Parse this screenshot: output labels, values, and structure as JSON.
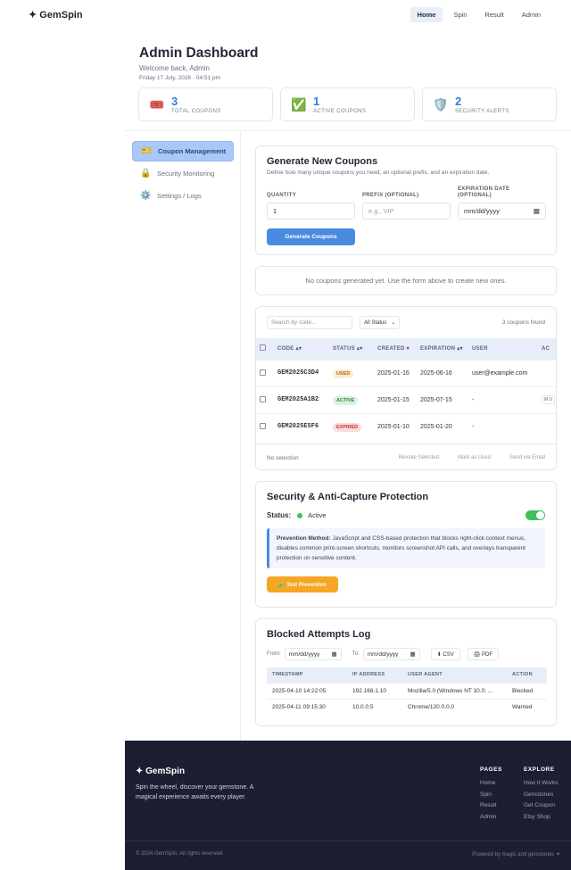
{
  "nav": {
    "brand": "✦ GemSpin",
    "links": [
      "Home",
      "Spin",
      "Result",
      "Admin"
    ],
    "active": "Home"
  },
  "header": {
    "title": "Admin Dashboard",
    "welcome": "Welcome back, Admin",
    "date": "Friday 17 July, 2026 · 04:51 pm"
  },
  "stats": [
    {
      "icon": "🎟️",
      "value": "3",
      "label": "TOTAL COUPONS"
    },
    {
      "icon": "✅",
      "value": "1",
      "label": "ACTIVE COUPONS"
    },
    {
      "icon": "🛡️",
      "value": "2",
      "label": "SECURITY ALERTS"
    }
  ],
  "sidebar": {
    "items": [
      {
        "icon": "🎫",
        "label": "Coupon Management"
      },
      {
        "icon": "🔒",
        "label": "Security Monitoring"
      },
      {
        "icon": "⚙️",
        "label": "Settings / Logs"
      }
    ]
  },
  "generate": {
    "title": "Generate New Coupons",
    "desc": "Define how many unique coupons you need, an optional prefix, and an expiration date.",
    "qty_label": "QUANTITY",
    "qty_value": "1",
    "prefix_label": "PREFIX (OPTIONAL)",
    "prefix_placeholder": "e.g., VIP",
    "exp_label": "EXPIRATION DATE (OPTIONAL)",
    "exp_value": "mm/dd/yyyy",
    "button": "Generate Coupons"
  },
  "empty_msg": "No coupons generated yet. Use the form above to create new ones.",
  "list": {
    "search_placeholder": "Search by code...",
    "filter": "All Status",
    "count": "3 coupons found",
    "headers": [
      "CODE ▴▾",
      "STATUS ▴▾",
      "CREATED ▾",
      "EXPIRATION ▴▾",
      "USER",
      "AC"
    ],
    "rows": [
      {
        "code": "GEM2025C3D4",
        "status": "USED",
        "created": "2025-01-16",
        "expiration": "2025-06-16",
        "user": "user@example.com",
        "action": ""
      },
      {
        "code": "GEM2025A1B2",
        "status": "ACTIVE",
        "created": "2025-01-15",
        "expiration": "2025-07-15",
        "user": "-",
        "action": "M U"
      },
      {
        "code": "GEM2025E5F6",
        "status": "EXPIRED",
        "created": "2025-01-10",
        "expiration": "2025-01-20",
        "user": "-",
        "action": ""
      }
    ],
    "selection": "No selection",
    "actions": [
      "Revoke Selected",
      "Mark as Used",
      "Send via Email"
    ]
  },
  "security": {
    "title": "Security & Anti-Capture Protection",
    "status_label": "Status:",
    "status_value": "Active",
    "note_bold": "Prevention Method:",
    "note_text": " JavaScript and CSS-based protection that blocks right-click context menus, disables common print-screen shortcuts, monitors screenshot API calls, and overlays transparent protection on sensitive content.",
    "button": "🧪 Test Prevention"
  },
  "log": {
    "title": "Blocked Attempts Log",
    "from_label": "From:",
    "from_value": "mm/dd/yyyy",
    "to_label": "To:",
    "to_value": "mm/dd/yyyy",
    "csv": "⬇ CSV",
    "pdf": "🖨 PDF",
    "headers": [
      "TIMESTAMP",
      "IP ADDRESS",
      "USER AGENT",
      "ACTION"
    ],
    "rows": [
      {
        "ts": "2025-04-10 14:22:05",
        "ip": "192.168.1.10",
        "ua": "Mozilla/5.0 (Windows NT 10.0; ...",
        "action": "Blocked"
      },
      {
        "ts": "2025-04-11 09:15:30",
        "ip": "10.0.0.5",
        "ua": "Chrome/120.0.0.0",
        "action": "Warned"
      }
    ]
  },
  "footer": {
    "brand": "✦ GemSpin",
    "tagline": "Spin the wheel, discover your gemstone. A magical experience awaits every player.",
    "pages_title": "PAGES",
    "pages": [
      "Home",
      "Spin",
      "Result",
      "Admin"
    ],
    "explore_title": "EXPLORE",
    "explore": [
      "How It Works",
      "Gemstones",
      "Get Coupon",
      "Etsy Shop"
    ],
    "copyright": "© 2024 GemSpin. All rights reserved.",
    "powered": "Powered by magic and gemstones ✦"
  },
  "colors": {
    "accent": "#4a8ae0",
    "warn": "#f5a623",
    "success": "#3fbf5f",
    "footer_bg": "#1e1e32"
  }
}
